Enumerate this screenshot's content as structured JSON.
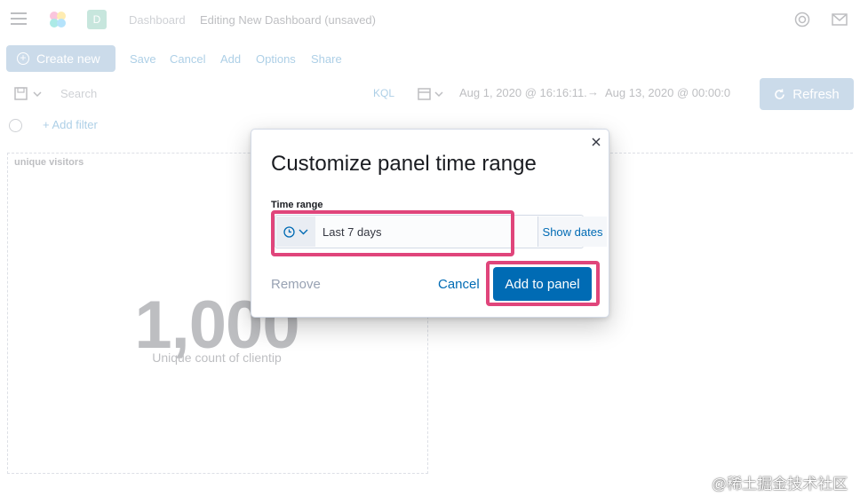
{
  "header": {
    "breadcrumb_dashboard": "Dashboard",
    "breadcrumb_current": "Editing New Dashboard (unsaved)",
    "space_avatar": "D"
  },
  "toolbar": {
    "create_new": "Create new",
    "save": "Save",
    "cancel": "Cancel",
    "add": "Add",
    "options": "Options",
    "share": "Share"
  },
  "query": {
    "search_placeholder": "Search",
    "language": "KQL",
    "start_date": "Aug 1, 2020 @ 16:16:11.",
    "arrow": "→",
    "end_date": "Aug 13, 2020 @ 00:00:0",
    "refresh": "Refresh"
  },
  "filters": {
    "add_filter": "+ Add filter"
  },
  "panel": {
    "title": "unique visitors",
    "metric_value": "1,000",
    "metric_label": "Unique count of clientip"
  },
  "modal": {
    "title": "Customize panel time range",
    "time_range_label": "Time range",
    "time_range_value": "Last 7 days",
    "show_dates": "Show dates",
    "remove": "Remove",
    "cancel": "Cancel",
    "add_to_panel": "Add to panel"
  },
  "watermark": "@稀土掘金技术社区",
  "colors": {
    "primary": "#006bb4",
    "highlight": "#e0457b",
    "disabled_primary": "#6092c0"
  }
}
